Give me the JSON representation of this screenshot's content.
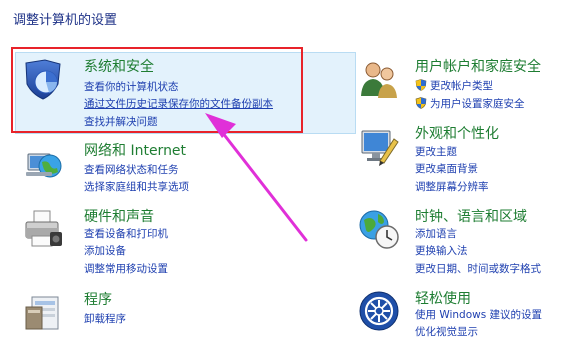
{
  "page_title": "调整计算机的设置",
  "left": [
    {
      "id": "system-security",
      "title": "系统和安全",
      "icon": "shield-pie-icon",
      "links": [
        "查看你的计算机状态",
        "通过文件历史记录保存你的文件备份副本",
        "查找并解决问题"
      ]
    },
    {
      "id": "network",
      "title": "网络和 Internet",
      "icon": "network-globe-icon",
      "links": [
        "查看网络状态和任务",
        "选择家庭组和共享选项"
      ]
    },
    {
      "id": "hardware-sound",
      "title": "硬件和声音",
      "icon": "printer-icon",
      "links": [
        "查看设备和打印机",
        "添加设备",
        "调整常用移动设置"
      ]
    },
    {
      "id": "programs",
      "title": "程序",
      "icon": "programs-icon",
      "links": [
        "卸载程序"
      ]
    }
  ],
  "right": [
    {
      "id": "user-accounts",
      "title": "用户帐户和家庭安全",
      "icon": "users-icon",
      "links": [
        "更改帐户类型",
        "为用户设置家庭安全"
      ]
    },
    {
      "id": "appearance",
      "title": "外观和个性化",
      "icon": "monitor-paint-icon",
      "links": [
        "更改主题",
        "更改桌面背景",
        "调整屏幕分辨率"
      ]
    },
    {
      "id": "clock-region",
      "title": "时钟、语言和区域",
      "icon": "clock-globe-icon",
      "links": [
        "添加语言",
        "更换输入法",
        "更改日期、时间或数字格式"
      ]
    },
    {
      "id": "ease-of-access",
      "title": "轻松使用",
      "icon": "ease-of-access-icon",
      "links": [
        "使用 Windows 建议的设置",
        "优化视觉显示"
      ]
    }
  ],
  "annotation": {
    "highlight_color": "#e8232a",
    "arrow_color": "#e030d8"
  }
}
